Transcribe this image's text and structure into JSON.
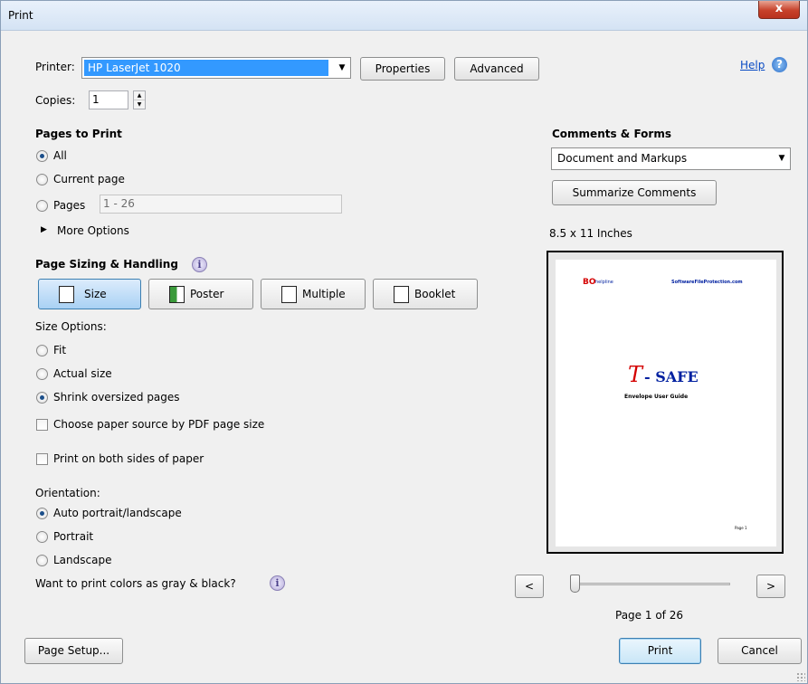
{
  "window": {
    "title": "Print",
    "close_glyph": "x"
  },
  "printer": {
    "label": "Printer:",
    "selected": "HP LaserJet 1020",
    "properties_label": "Properties",
    "advanced_label": "Advanced"
  },
  "help": {
    "label": "Help",
    "icon": "help-icon"
  },
  "copies": {
    "label": "Copies:",
    "value": "1"
  },
  "pages_to_print": {
    "heading": "Pages to Print",
    "all": "All",
    "current": "Current page",
    "pages": "Pages",
    "pages_value": "1 - 26",
    "more_options": "More Options",
    "selected": "all"
  },
  "sizing": {
    "heading": "Page Sizing & Handling",
    "info_glyph": "i",
    "buttons": [
      "Size",
      "Poster",
      "Multiple",
      "Booklet"
    ],
    "active": "Size",
    "size_options_label": "Size Options:",
    "fit": "Fit",
    "actual": "Actual size",
    "shrink": "Shrink oversized pages",
    "selected": "shrink",
    "paper_source": "Choose paper source by PDF page size",
    "both_sides": "Print on both sides of paper"
  },
  "orientation": {
    "label": "Orientation:",
    "auto": "Auto portrait/landscape",
    "portrait": "Portrait",
    "landscape": "Landscape",
    "selected": "auto"
  },
  "grayscale": {
    "label": "Want to print colors as gray & black?",
    "info_glyph": "i"
  },
  "comments": {
    "heading": "Comments & Forms",
    "selected": "Document and Markups",
    "summarize_label": "Summarize Comments"
  },
  "preview": {
    "paper_size": "8.5 x 11 Inches",
    "logo_text": "helpline",
    "logo_mark": "BO",
    "site": "SoftwareFileProtection.com",
    "product_mark": "T",
    "product_name": "- SAFE",
    "subtitle": "Envelope User Guide",
    "page_footer": "Page 1",
    "prev_label": "<",
    "next_label": ">",
    "page_indicator": "Page 1 of 26",
    "slider_position": 0
  },
  "footer": {
    "page_setup": "Page Setup...",
    "print": "Print",
    "cancel": "Cancel"
  },
  "colors": {
    "accent": "#3c7fb1",
    "selection": "#3399ff",
    "product_red": "#d40000",
    "product_blue": "#0020a0"
  }
}
